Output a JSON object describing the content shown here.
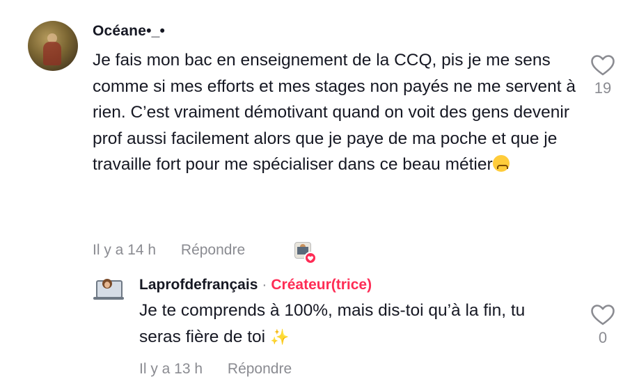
{
  "comment": {
    "username": "Océane•_•",
    "text": "Je fais mon bac en enseignement de la CCQ, pis je me sens comme si mes efforts et mes stages non payés ne me servent à rien. C’est vraiment démotivant quand on voit des gens devenir prof aussi facilement alors que je paye de ma poche et que je travaille fort pour me spécialiser dans ce beau métier",
    "emoji": "😥",
    "time": "Il y a 14 h",
    "reply_label": "Répondre",
    "like_count": "19",
    "liked_by_creator": true
  },
  "reply": {
    "username": "Laprofdefrançais",
    "separator": "·",
    "badge": "Créateur(trice)",
    "text": "Je te comprends à 100%, mais dis-toi qu’à la fin, tu seras fière de toi",
    "emoji": "✨",
    "time": "Il y a 13 h",
    "reply_label": "Répondre",
    "like_count": "0"
  },
  "colors": {
    "text": "#161823",
    "muted": "#8a8b91",
    "accent": "#fe2c55"
  },
  "icons": {
    "like": "heart-outline-icon",
    "creator_like": "creator-liked-heart-icon"
  }
}
